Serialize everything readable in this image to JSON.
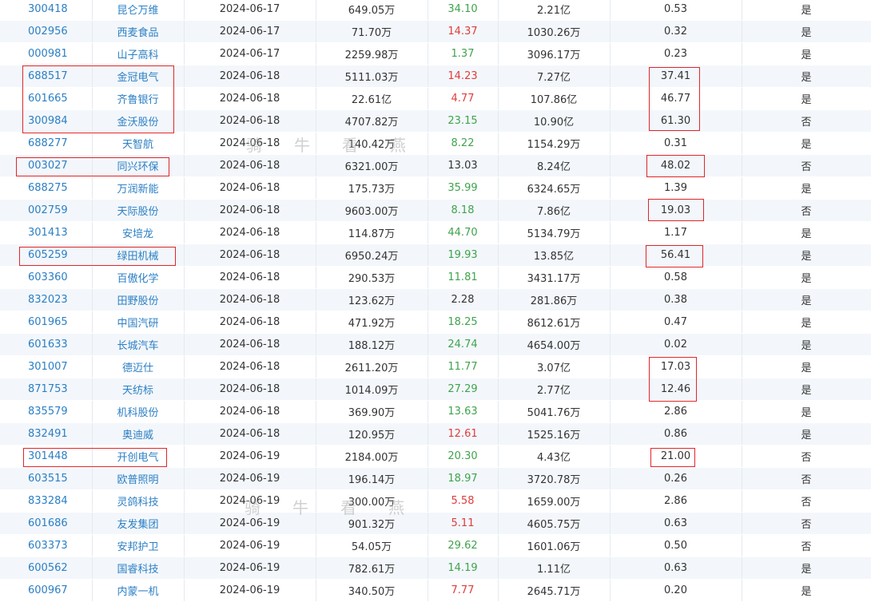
{
  "table": {
    "rows": [
      {
        "code": "300418",
        "name": "昆仑万维",
        "date": "2024-06-17",
        "amount": "649.05万",
        "change": "34.10",
        "dir": "down",
        "cap": "2.21亿",
        "ratio": "0.53",
        "flag": "是"
      },
      {
        "code": "002956",
        "name": "西麦食品",
        "date": "2024-06-17",
        "amount": "71.70万",
        "change": "14.37",
        "dir": "up",
        "cap": "1030.26万",
        "ratio": "0.32",
        "flag": "是"
      },
      {
        "code": "000981",
        "name": "山子高科",
        "date": "2024-06-17",
        "amount": "2259.98万",
        "change": "1.37",
        "dir": "down",
        "cap": "3096.17万",
        "ratio": "0.23",
        "flag": "是"
      },
      {
        "code": "688517",
        "name": "金冠电气",
        "date": "2024-06-18",
        "amount": "5111.03万",
        "change": "14.23",
        "dir": "up",
        "cap": "7.27亿",
        "ratio": "37.41",
        "flag": "是"
      },
      {
        "code": "601665",
        "name": "齐鲁银行",
        "date": "2024-06-18",
        "amount": "22.61亿",
        "change": "4.77",
        "dir": "up",
        "cap": "107.86亿",
        "ratio": "46.77",
        "flag": "是"
      },
      {
        "code": "300984",
        "name": "金沃股份",
        "date": "2024-06-18",
        "amount": "4707.82万",
        "change": "23.15",
        "dir": "down",
        "cap": "10.90亿",
        "ratio": "61.30",
        "flag": "否"
      },
      {
        "code": "688277",
        "name": "天智航",
        "date": "2024-06-18",
        "amount": "140.42万",
        "change": "8.22",
        "dir": "down",
        "cap": "1154.29万",
        "ratio": "0.31",
        "flag": "是"
      },
      {
        "code": "003027",
        "name": "同兴环保",
        "date": "2024-06-18",
        "amount": "6321.00万",
        "change": "13.03",
        "dir": "flat",
        "cap": "8.24亿",
        "ratio": "48.02",
        "flag": "否"
      },
      {
        "code": "688275",
        "name": "万润新能",
        "date": "2024-06-18",
        "amount": "175.73万",
        "change": "35.99",
        "dir": "down",
        "cap": "6324.65万",
        "ratio": "1.39",
        "flag": "是"
      },
      {
        "code": "002759",
        "name": "天际股份",
        "date": "2024-06-18",
        "amount": "9603.00万",
        "change": "8.18",
        "dir": "down",
        "cap": "7.86亿",
        "ratio": "19.03",
        "flag": "否"
      },
      {
        "code": "301413",
        "name": "安培龙",
        "date": "2024-06-18",
        "amount": "114.87万",
        "change": "44.70",
        "dir": "down",
        "cap": "5134.79万",
        "ratio": "1.17",
        "flag": "是"
      },
      {
        "code": "605259",
        "name": "绿田机械",
        "date": "2024-06-18",
        "amount": "6950.24万",
        "change": "19.93",
        "dir": "down",
        "cap": "13.85亿",
        "ratio": "56.41",
        "flag": "是"
      },
      {
        "code": "603360",
        "name": "百傲化学",
        "date": "2024-06-18",
        "amount": "290.53万",
        "change": "11.81",
        "dir": "down",
        "cap": "3431.17万",
        "ratio": "0.58",
        "flag": "是"
      },
      {
        "code": "832023",
        "name": "田野股份",
        "date": "2024-06-18",
        "amount": "123.62万",
        "change": "2.28",
        "dir": "flat",
        "cap": "281.86万",
        "ratio": "0.38",
        "flag": "是"
      },
      {
        "code": "601965",
        "name": "中国汽研",
        "date": "2024-06-18",
        "amount": "471.92万",
        "change": "18.25",
        "dir": "down",
        "cap": "8612.61万",
        "ratio": "0.47",
        "flag": "是"
      },
      {
        "code": "601633",
        "name": "长城汽车",
        "date": "2024-06-18",
        "amount": "188.12万",
        "change": "24.74",
        "dir": "down",
        "cap": "4654.00万",
        "ratio": "0.02",
        "flag": "是"
      },
      {
        "code": "301007",
        "name": "德迈仕",
        "date": "2024-06-18",
        "amount": "2611.20万",
        "change": "11.77",
        "dir": "down",
        "cap": "3.07亿",
        "ratio": "17.03",
        "flag": "是"
      },
      {
        "code": "871753",
        "name": "天纺标",
        "date": "2024-06-18",
        "amount": "1014.09万",
        "change": "27.29",
        "dir": "down",
        "cap": "2.77亿",
        "ratio": "12.46",
        "flag": "是"
      },
      {
        "code": "835579",
        "name": "机科股份",
        "date": "2024-06-18",
        "amount": "369.90万",
        "change": "13.63",
        "dir": "down",
        "cap": "5041.76万",
        "ratio": "2.86",
        "flag": "是"
      },
      {
        "code": "832491",
        "name": "奥迪威",
        "date": "2024-06-18",
        "amount": "120.95万",
        "change": "12.61",
        "dir": "up",
        "cap": "1525.16万",
        "ratio": "0.86",
        "flag": "是"
      },
      {
        "code": "301448",
        "name": "开创电气",
        "date": "2024-06-19",
        "amount": "2184.00万",
        "change": "20.30",
        "dir": "down",
        "cap": "4.43亿",
        "ratio": "21.00",
        "flag": "否"
      },
      {
        "code": "603515",
        "name": "欧普照明",
        "date": "2024-06-19",
        "amount": "196.14万",
        "change": "18.97",
        "dir": "down",
        "cap": "3720.78万",
        "ratio": "0.26",
        "flag": "否"
      },
      {
        "code": "833284",
        "name": "灵鸽科技",
        "date": "2024-06-19",
        "amount": "300.00万",
        "change": "5.58",
        "dir": "up",
        "cap": "1659.00万",
        "ratio": "2.86",
        "flag": "否"
      },
      {
        "code": "601686",
        "name": "友发集团",
        "date": "2024-06-19",
        "amount": "901.32万",
        "change": "5.11",
        "dir": "up",
        "cap": "4605.75万",
        "ratio": "0.63",
        "flag": "否"
      },
      {
        "code": "603373",
        "name": "安邦护卫",
        "date": "2024-06-19",
        "amount": "54.05万",
        "change": "29.62",
        "dir": "down",
        "cap": "1601.06万",
        "ratio": "0.50",
        "flag": "否"
      },
      {
        "code": "600562",
        "name": "国睿科技",
        "date": "2024-06-19",
        "amount": "782.61万",
        "change": "14.19",
        "dir": "down",
        "cap": "1.11亿",
        "ratio": "0.63",
        "flag": "是"
      },
      {
        "code": "600967",
        "name": "内蒙一机",
        "date": "2024-06-19",
        "amount": "340.50万",
        "change": "7.77",
        "dir": "up",
        "cap": "2645.71万",
        "ratio": "0.20",
        "flag": "是"
      }
    ]
  },
  "watermark": {
    "line1": "骑牛看燕",
    "line2": "骑牛看燕"
  },
  "colors": {
    "code_link": "#2b7fc4",
    "up": "#e03c3c",
    "down": "#3fa34d",
    "highlight_box": "#e0262a"
  }
}
